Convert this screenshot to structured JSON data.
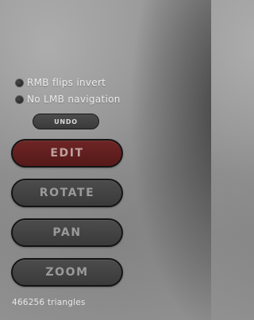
{
  "options": [
    {
      "label": "RMB flips invert",
      "icon": "radio-dot-icon"
    },
    {
      "label": "No LMB navigation",
      "icon": "radio-dot-icon"
    }
  ],
  "toolbar": {
    "undo_label": "UNDO",
    "edit_label": "EDIT",
    "rotate_label": "ROTATE",
    "pan_label": "PAN",
    "zoom_label": "ZOOM",
    "active_mode": "EDIT"
  },
  "status": {
    "triangle_count": "466256 triangles"
  },
  "colors": {
    "active_button": "#6e2525",
    "inactive_button": "#444444",
    "button_border": "#141414",
    "label_text": "#ececec"
  }
}
